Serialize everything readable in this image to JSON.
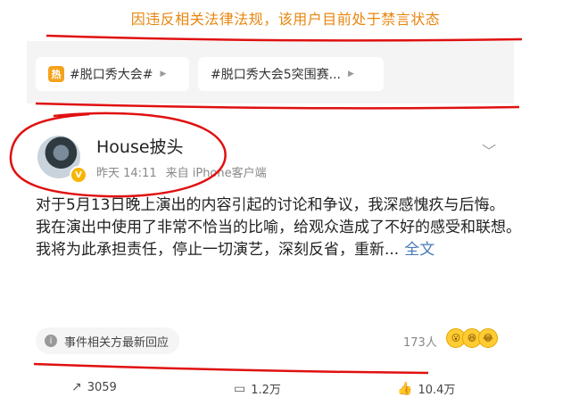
{
  "notice": "因违反相关法律法规，该用户目前处于禁言状态",
  "topics": [
    {
      "hot_icon": "热",
      "label": "#脱口秀大会#"
    },
    {
      "label": "#脱口秀大会5突围赛..."
    }
  ],
  "user": {
    "name": "House披头",
    "badge": "V"
  },
  "meta": {
    "time": "昨天 14:11",
    "source": "来自 iPhone客户端"
  },
  "post": {
    "p1": "对于5月13日晚上演出的内容引起的讨论和争议，我深感愧疚与后悔。",
    "p2": "我在演出中使用了非常不恰当的比喻，给观众造成了不好的感受和联想。",
    "p3": "我将为此承担责任，停止一切演艺，深刻反省，重新...",
    "more": "全文"
  },
  "response_chip": "事件相关方最新回应",
  "reactions": {
    "count": "173人",
    "emojis": [
      "😮",
      "😆",
      "😂"
    ]
  },
  "actions": {
    "repost": "3059",
    "comment": "1.2万",
    "like": "10.4万"
  },
  "icons": {
    "chevron": "chevron-right-icon",
    "menu": "chevron-down-icon",
    "info": "info-icon"
  },
  "colors": {
    "notice": "#e8860e",
    "annotation": "#e01010",
    "link": "#4a7ab5",
    "hot": "#f5a21b"
  }
}
